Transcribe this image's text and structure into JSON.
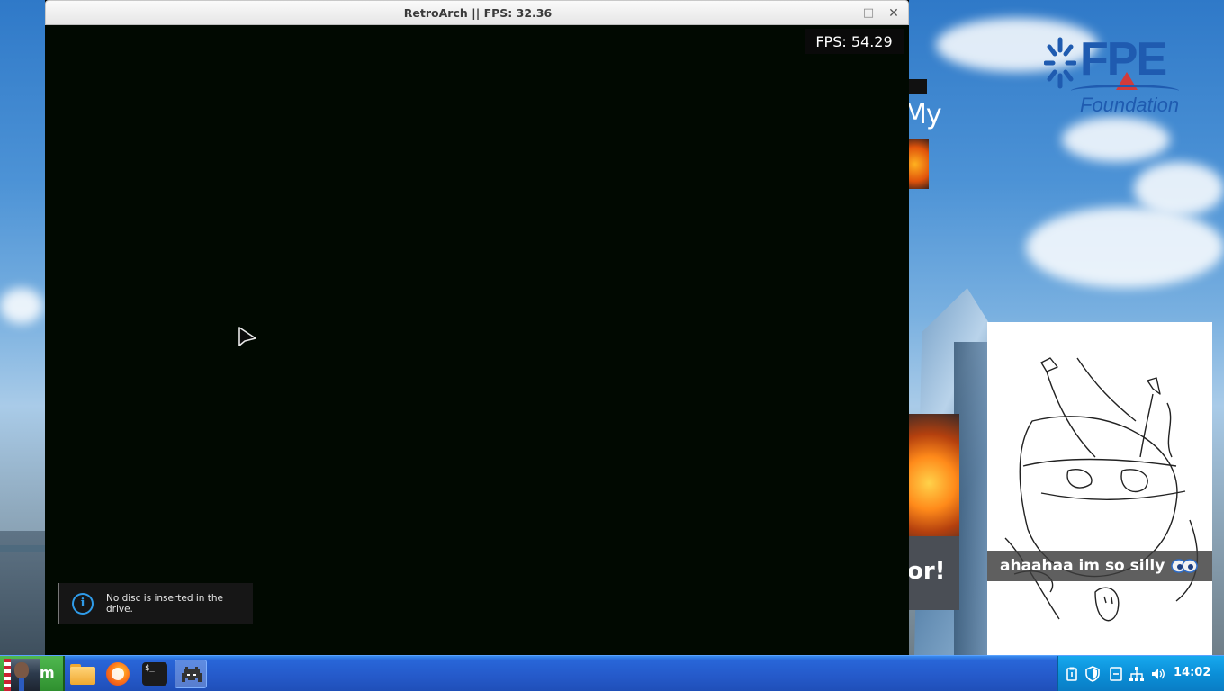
{
  "window": {
    "title": "RetroArch || FPS:  32.36",
    "minimize_glyph": "–",
    "maximize_glyph": "□",
    "close_glyph": "✕"
  },
  "overlay": {
    "fps_text": "FPS:  54.29"
  },
  "notification": {
    "icon": "info-icon",
    "icon_glyph": "i",
    "message": "No disc is inserted in the drive."
  },
  "wallpaper": {
    "logo_text": "FPE",
    "logo_subtext": "Foundation",
    "fragment_my": "My",
    "fragment_or": "or!",
    "caption": "ahaahaa im so silly"
  },
  "taskbar": {
    "start_label": "m",
    "apps": [
      {
        "name": "file-manager",
        "icon": "folder-icon"
      },
      {
        "name": "firefox",
        "icon": "firefox-icon"
      },
      {
        "name": "terminal",
        "icon": "terminal-icon",
        "text": "$_"
      },
      {
        "name": "retroarch",
        "icon": "space-invader-icon"
      }
    ],
    "tray": {
      "icons": [
        "clipboard-icon",
        "shield-icon",
        "notes-icon",
        "network-icon",
        "volume-icon"
      ],
      "clock": "14:02"
    }
  },
  "colors": {
    "taskbar_blue": "#2559c9",
    "tray_blue": "#0b8fd8",
    "start_green": "#3aa43a",
    "info_blue": "#2f9be8",
    "content_bg": "#010901"
  }
}
